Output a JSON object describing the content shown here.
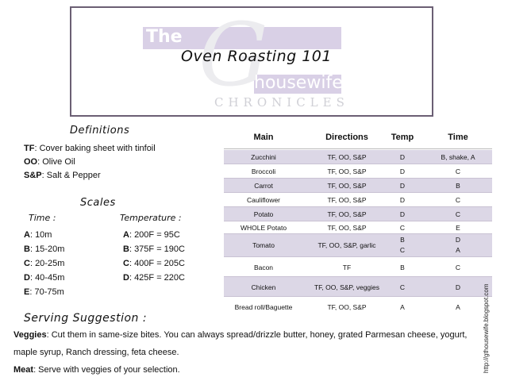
{
  "header": {
    "title": "Oven Roasting 101",
    "logo_the": "The",
    "logo_g": "G",
    "logo_housewife": "housewife",
    "logo_chronicles": "CHRONICLES"
  },
  "definitions": {
    "heading": "Definitions",
    "items": [
      {
        "key": "TF",
        "text": ": Cover baking sheet with tinfoil"
      },
      {
        "key": "OO",
        "text": ": Olive Oil"
      },
      {
        "key": "S&P",
        "text": ": Salt & Pepper"
      }
    ]
  },
  "scales": {
    "heading": "Scales",
    "time_label": "Time :",
    "temp_label": "Temperature :",
    "time": [
      {
        "key": "A",
        "text": ": 10m"
      },
      {
        "key": "B",
        "text": ": 15-20m"
      },
      {
        "key": "C",
        "text": ": 20-25m"
      },
      {
        "key": "D",
        "text": ": 40-45m"
      },
      {
        "key": "E",
        "text": ": 70-75m"
      }
    ],
    "temperature": [
      {
        "key": "A",
        "text": ": 200F = 95C"
      },
      {
        "key": "B",
        "text": ": 375F = 190C"
      },
      {
        "key": "C",
        "text": ": 400F = 205C"
      },
      {
        "key": "D",
        "text": ": 425F = 220C"
      }
    ]
  },
  "table": {
    "headers": [
      "Main",
      "Directions",
      "Temp",
      "Time"
    ],
    "rows": [
      {
        "main": "Zucchini",
        "directions": "TF, OO, S&P",
        "temp": "D",
        "time": "B, shake, A"
      },
      {
        "main": "Broccoli",
        "directions": "TF, OO, S&P",
        "temp": "D",
        "time": "C"
      },
      {
        "main": "Carrot",
        "directions": "TF, OO, S&P",
        "temp": "D",
        "time": "B"
      },
      {
        "main": "Cauliflower",
        "directions": "TF, OO, S&P",
        "temp": "D",
        "time": "C"
      },
      {
        "main": "Potato",
        "directions": "TF, OO, S&P",
        "temp": "D",
        "time": "C"
      },
      {
        "main": "WHOLE Potato",
        "directions": "TF, OO, S&P",
        "temp": "C",
        "time": "E"
      },
      {
        "main": "Tomato",
        "directions": "TF, OO, S&P, garlic",
        "temp": "B",
        "temp2": "C",
        "time": "D",
        "time2": "A"
      },
      {
        "main": "Bacon",
        "directions": "TF",
        "temp": "B",
        "time": "C"
      },
      {
        "main": "Chicken",
        "directions": "TF, OO, S&P, veggies",
        "temp": "C",
        "time": "D"
      },
      {
        "main": "Bread roll/Baguette",
        "directions": "TF, OO, S&P",
        "temp": "A",
        "time": "A"
      }
    ]
  },
  "serving": {
    "heading": "Serving Suggestion :",
    "veggies_key": "Veggies",
    "veggies_line1": ": Cut them in same-size bites.  You can always spread/drizzle butter, honey, grated Parmesan cheese, yogurt,",
    "veggies_line2": "maple syrup, Ranch dressing, feta cheese.",
    "meat_key": "Meat",
    "meat_text": ": Serve with veggies of your selection."
  },
  "url": "http://gthousewife.blogspot.com"
}
